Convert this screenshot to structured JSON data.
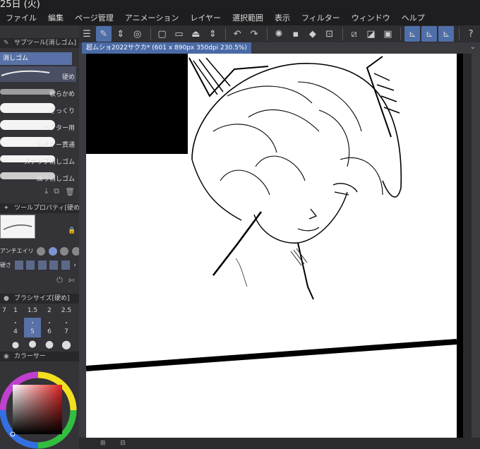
{
  "header": {
    "date": "25日 (火)"
  },
  "menu": [
    "ファイル",
    "編集",
    "ページ管理",
    "アニメーション",
    "レイヤー",
    "選択範囲",
    "表示",
    "フィルター",
    "ウィンドウ",
    "ヘルプ"
  ],
  "subtool": {
    "panel_title": "サブツール[消しゴム]",
    "group_label": "消しゴム",
    "items": [
      {
        "label": "硬め"
      },
      {
        "label": "軟らかめ"
      },
      {
        "label": "ざっくり"
      },
      {
        "label": "ベクター用"
      },
      {
        "label": "レイヤー貫通"
      },
      {
        "label": "スナップ消しゴム"
      },
      {
        "label": "練り消しゴム"
      }
    ]
  },
  "tool_property": {
    "panel_title": "ツールプロパティ[硬め]",
    "antialias_label": "アンチエイリ",
    "hardness_label": "硬さ"
  },
  "brush_size": {
    "panel_title": "ブラシサイズ[硬め]",
    "row1": [
      "7",
      "1",
      "1.5",
      "2",
      "2.5"
    ],
    "row2": [
      "4",
      "5",
      "6",
      "7"
    ],
    "selected": "5"
  },
  "color": {
    "panel_title": "カラーサー"
  },
  "canvas": {
    "tab_title": "超ムショ2022サクカ* (601 x 890px 350dpi 230.5%)"
  }
}
